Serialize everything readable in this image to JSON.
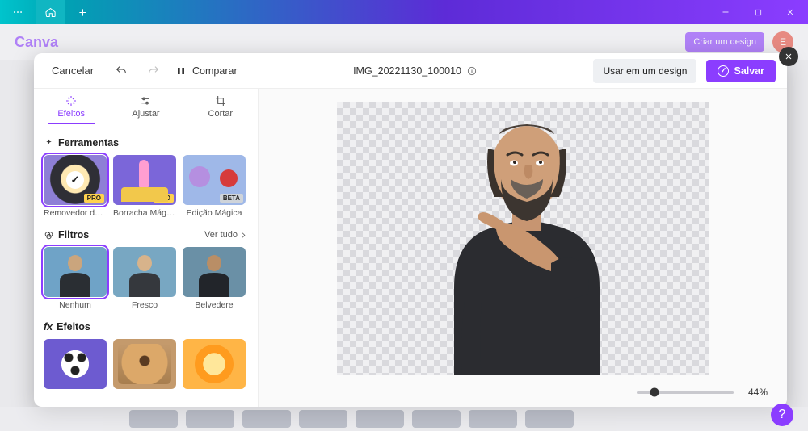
{
  "window": {
    "logo": "Canva",
    "create": "Criar um design",
    "avatarInitial": "E"
  },
  "modal": {
    "cancel": "Cancelar",
    "compare": "Comparar",
    "filename": "IMG_20221130_100010",
    "useInDesign": "Usar em um design",
    "save": "Salvar"
  },
  "tabs": {
    "effects": "Efeitos",
    "adjust": "Ajustar",
    "crop": "Cortar",
    "active": "effects"
  },
  "sections": {
    "tools": {
      "title": "Ferramentas",
      "items": [
        {
          "label": "Removedor de ...",
          "badge": "PRO",
          "selected": true
        },
        {
          "label": "Borracha Mágica",
          "badge": "PRO",
          "selected": false
        },
        {
          "label": "Edição Mágica",
          "badge": "BETA",
          "selected": false
        }
      ]
    },
    "filters": {
      "title": "Filtros",
      "seeAll": "Ver tudo",
      "items": [
        {
          "label": "Nenhum",
          "selected": true
        },
        {
          "label": "Fresco",
          "selected": false
        },
        {
          "label": "Belvedere",
          "selected": false
        }
      ]
    },
    "effects": {
      "title": "Efeitos"
    }
  },
  "zoom": {
    "percent": "44%",
    "value": 0.18
  },
  "colors": {
    "accent": "#8b3dff",
    "teal": "#00c4cc"
  }
}
